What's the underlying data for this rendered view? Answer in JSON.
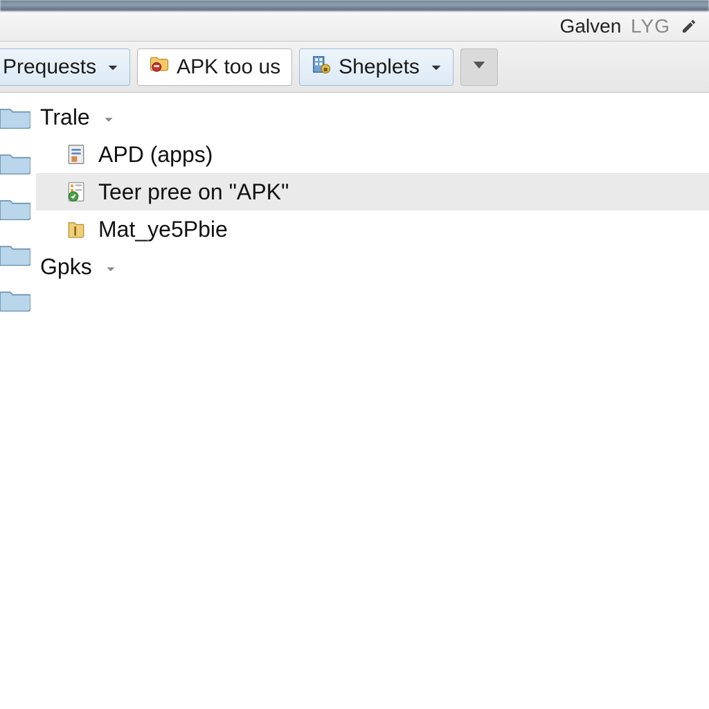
{
  "header": {
    "user_name": "Galven",
    "user_suffix": "LYG"
  },
  "toolbar": {
    "buttons": [
      {
        "label": "Prequests",
        "has_dropdown": true,
        "active": false
      },
      {
        "label": "APK too us",
        "has_dropdown": false,
        "active": true
      },
      {
        "label": "Sheplets",
        "has_dropdown": true,
        "active": false
      }
    ]
  },
  "tree": {
    "groups": [
      {
        "label": "Trale",
        "expanded": true,
        "children": [
          {
            "label": "APD (apps)",
            "icon": "app-file-icon",
            "selected": false
          },
          {
            "label": "Teer pree on \"APK\"",
            "icon": "settings-file-icon",
            "selected": true
          },
          {
            "label": "Mat_ye5Pbie",
            "icon": "archive-file-icon",
            "selected": false
          }
        ]
      },
      {
        "label": "Gpks",
        "expanded": false,
        "children": []
      }
    ]
  }
}
